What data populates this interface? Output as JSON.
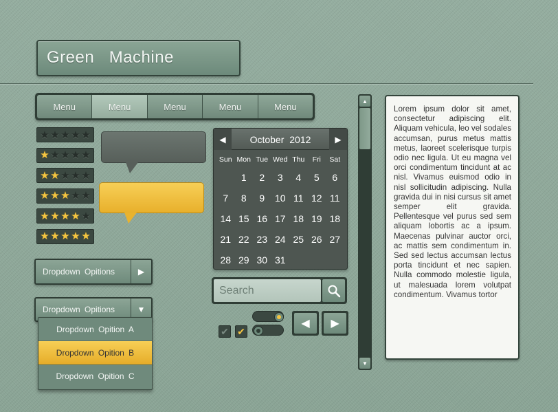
{
  "title": "Green   Machine",
  "menu": {
    "items": [
      "Menu",
      "Menu",
      "Menu",
      "Menu",
      "Menu"
    ],
    "active_index": 1
  },
  "ratings": [
    0,
    1,
    2,
    3,
    4,
    5
  ],
  "calendar": {
    "month_label": "October  2012",
    "prev_icon": "left-triangle",
    "next_icon": "right-triangle",
    "days_of_week": [
      "Sun",
      "Mon",
      "Tue",
      "Wed",
      "Thu",
      "Fri",
      "Sat"
    ],
    "weeks": [
      [
        "",
        "1",
        "2",
        "3",
        "4",
        "5",
        "6"
      ],
      [
        "7",
        "8",
        "9",
        "10",
        "11",
        "12",
        "11"
      ],
      [
        "14",
        "15",
        "16",
        "17",
        "18",
        "19",
        "18"
      ],
      [
        "21",
        "22",
        "23",
        "24",
        "25",
        "26",
        "27"
      ],
      [
        "28",
        "29",
        "30",
        "31",
        "",
        "",
        ""
      ]
    ]
  },
  "dropdown1": {
    "label": "Dropdown  Opitions",
    "icon": "right-triangle"
  },
  "dropdown2": {
    "label": "Dropdown  Opitions",
    "icon": "down-triangle",
    "options": [
      "Dropdown  Opition  A",
      "Dropdown  Opition  B",
      "Dropdown  Opition  C"
    ],
    "selected_index": 1
  },
  "search": {
    "placeholder": "Search",
    "icon": "magnifier-icon"
  },
  "checkboxes": [
    {
      "checked": true,
      "color": "#7a8a82"
    },
    {
      "checked": true,
      "color": "#f4c542"
    }
  ],
  "toggles": [
    {
      "state": "right",
      "dot_color": "#f4c542"
    },
    {
      "state": "left",
      "dot_color": "#2f3d35"
    }
  ],
  "arrows": {
    "prev": "◀",
    "next": "▶"
  },
  "scrollbar": {
    "up": "▲",
    "down": "▼"
  },
  "colors": {
    "accent": "#f4c542",
    "dark": "#2f3d35",
    "green": "#7e9888"
  },
  "body_text": "Lorem ipsum dolor sit amet, consectetur adipiscing elit. Aliquam vehicula, leo vel sodales accumsan, purus metus mattis metus, laoreet scelerisque turpis odio nec ligula. Ut eu magna vel orci condimentum tincidunt at ac nisl. Vivamus euismod odio in nisl sollicitudin adipiscing. Nulla gravida dui in nisi cursus sit amet semper elit gravida. Pellentesque vel purus sed sem aliquam lobortis ac a ipsum. Maecenas pulvinar auctor orci, ac mattis sem condimentum in. Sed sed lectus accumsan lectus porta tincidunt et nec sapien. Nulla commodo molestie ligula, ut malesuada lorem volutpat condimentum. Vivamus tortor"
}
